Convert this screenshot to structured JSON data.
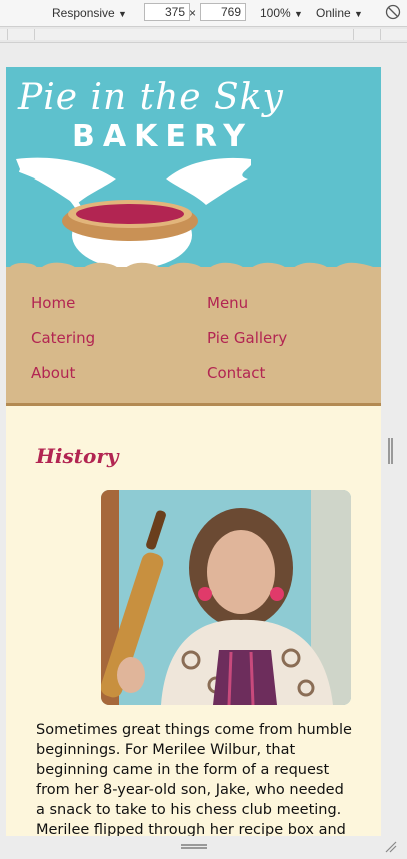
{
  "devtools": {
    "device_label": "Responsive",
    "width_value": "375",
    "times_symbol": "×",
    "height_value": "769",
    "zoom_label": "100%",
    "network_label": "Online",
    "dropdown_arrow": "▼"
  },
  "site": {
    "logo_title": "Pie in the Sky",
    "logo_sub": "BAKERY",
    "nav": [
      {
        "label": "Home"
      },
      {
        "label": "Menu"
      },
      {
        "label": "Catering"
      },
      {
        "label": "Pie Gallery"
      },
      {
        "label": "About"
      },
      {
        "label": "Contact"
      }
    ],
    "section_title": "History",
    "paragraph": "Sometimes great things come from humble beginnings. For Merilee Wilbur, that beginning came in the form of a request from her 8-year-old son, Jake, who needed a snack to take to his chess club meeting. Merilee flipped through her recipe box and pulled out her"
  },
  "colors": {
    "sky": "#5ec1cd",
    "crust": "#d7b98a",
    "accent": "#b22552",
    "cream": "#fdf6dc"
  },
  "icons": [
    "rotate-device-icon",
    "resize-corner-icon",
    "wings-icon",
    "pie-icon"
  ]
}
